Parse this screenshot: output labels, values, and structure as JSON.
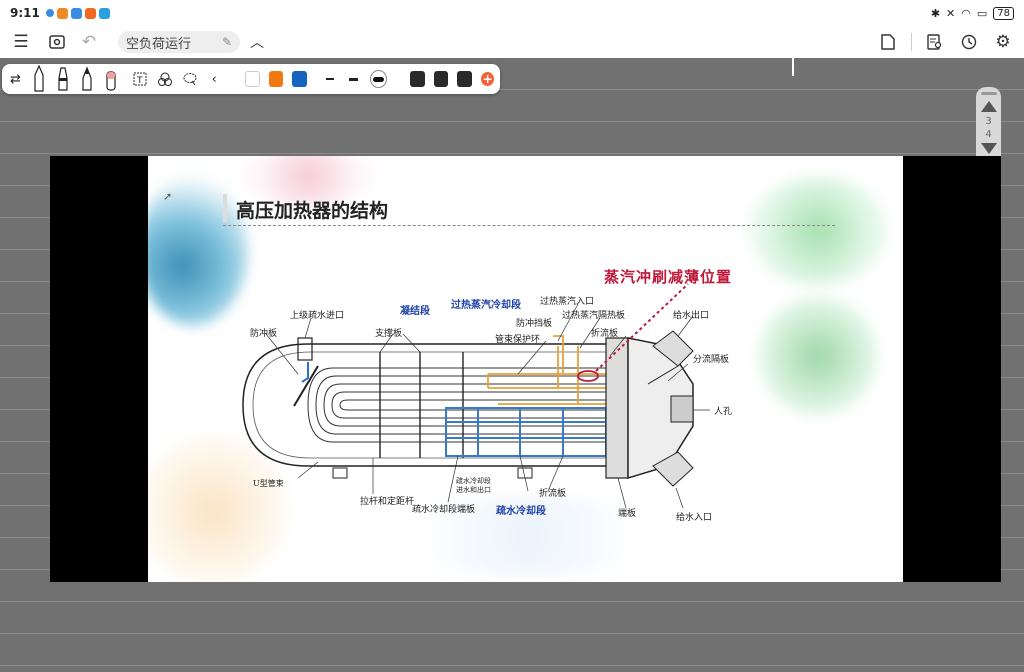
{
  "status": {
    "time": "9:11",
    "battery": "78"
  },
  "app": {
    "doc_title": "空负荷运行"
  },
  "toolbar": {
    "colors": [
      "#f07a10",
      "#1565c0",
      "#2a2a2a",
      "#2a2a2a",
      "#2a2a2a"
    ]
  },
  "page_nav": {
    "pages": [
      "3",
      "4"
    ]
  },
  "slide": {
    "title": "高压加热器的结构",
    "labels": {
      "erosion": "蒸汽冲刷减薄位置",
      "condensing": "凝结段",
      "desuperheat": "过热蒸汽冷却段",
      "drain_cooling": "疏水冷却段",
      "upper_drain_inlet": "上级疏水进口",
      "impingement": "防冲板",
      "support": "支撑板",
      "steam_inlet": "过热蒸汽入口",
      "baffle_guard": "防冲挡板",
      "shield_plate": "过热蒸汽隔热板",
      "tube_ring": "管束保护环",
      "baffle": "折流板",
      "water_outlet": "给水出口",
      "pass_partition": "分流隔板",
      "manhole": "人孔",
      "u_tube": "U型管束",
      "tie_rod": "拉杆和定距杆",
      "drain_endplate": "疏水冷却段端板",
      "drain_inlet_outlet_1": "疏水冷却段",
      "drain_inlet_outlet_2": "进水和出口",
      "baffle2": "折流板",
      "tube_sheet": "端板",
      "water_inlet": "给水入口"
    }
  }
}
